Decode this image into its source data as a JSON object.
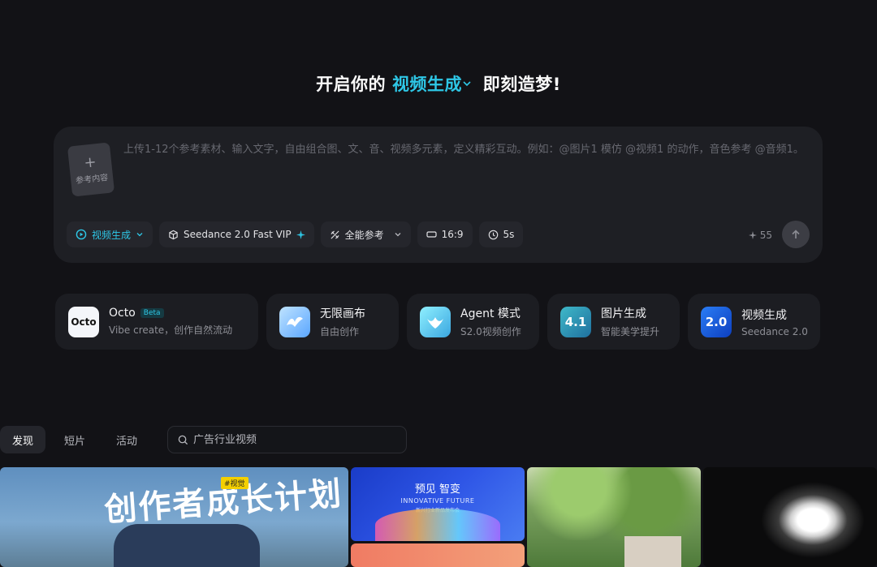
{
  "headline": {
    "prefix": "开启你的",
    "mode": "视频生成",
    "suffix": "即刻造梦!"
  },
  "composer": {
    "ref_plus": "+",
    "ref_label": "参考内容",
    "placeholder": "上传1-12个参考素材、输入文字，自由组合图、文、音、视频多元素，定义精彩互动。例如：@图片1 模仿 @视频1 的动作，音色参考 @音频1。",
    "toolbar": {
      "mode_label": "视频生成",
      "model_label": "Seedance 2.0 Fast VIP",
      "reference_label": "全能参考",
      "ratio_label": "16:9",
      "duration_label": "5s"
    },
    "credits": "55"
  },
  "features": [
    {
      "title": "Octo",
      "badge": "Beta",
      "subtitle": "Vibe create，创作自然流动",
      "icon_text": "Octo"
    },
    {
      "title": "无限画布",
      "subtitle": "自由创作"
    },
    {
      "title": "Agent 模式",
      "subtitle": "S2.0视频创作"
    },
    {
      "title": "图片生成",
      "subtitle": "智能美学提升",
      "icon_text": "4.1"
    },
    {
      "title": "视频生成",
      "subtitle": "Seedance 2.0",
      "icon_text": "2.0"
    }
  ],
  "tabs": [
    "发现",
    "短片",
    "活动"
  ],
  "search": {
    "placeholder": "广告行业视频"
  },
  "gallery": {
    "tile1_art": "创作者成长计划",
    "tile1_tag": "#视觉",
    "tile2_title": "预见 智变",
    "tile2_sub": "INNOVATIVE FUTURE",
    "tile2_small": "新兴行业新品发布会"
  },
  "colors": {
    "accent": "#2ec7e6",
    "background": "#121216",
    "panel": "#1e1f24"
  }
}
